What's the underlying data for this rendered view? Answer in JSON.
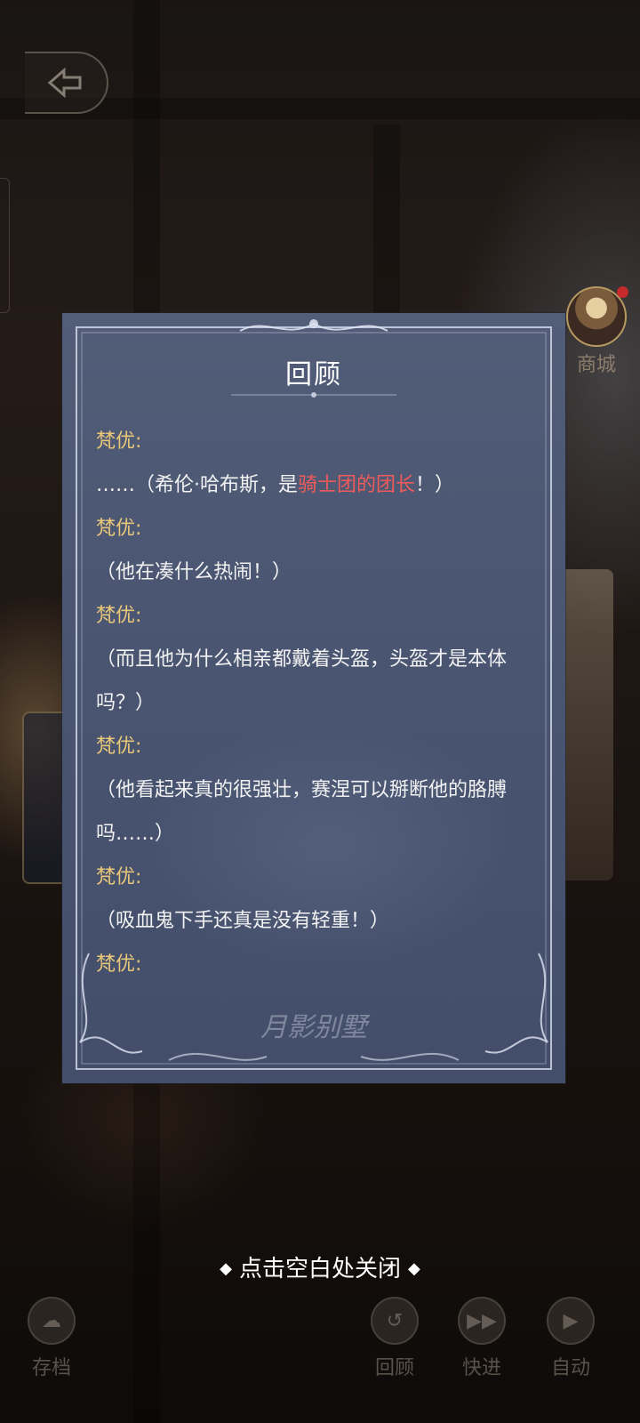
{
  "panel": {
    "title": "回顾",
    "logo_text": "月影别墅",
    "entries": [
      {
        "speaker": "梵优:",
        "segments": [
          {
            "text": "……（希伦·哈布斯，是"
          },
          {
            "text": "骑士团的团长",
            "hl": true
          },
          {
            "text": "！）"
          }
        ]
      },
      {
        "speaker": "梵优:",
        "segments": [
          {
            "text": "（他在凑什么热闹！）"
          }
        ]
      },
      {
        "speaker": "梵优:",
        "segments": [
          {
            "text": "（而且他为什么相亲都戴着头盔，头盔才是本体吗？）"
          }
        ]
      },
      {
        "speaker": "梵优:",
        "segments": [
          {
            "text": "（他看起来真的很强壮，赛涅可以掰断他的胳膊吗……）"
          }
        ]
      },
      {
        "speaker": "梵优:",
        "segments": [
          {
            "text": "（吸血鬼下手还真是没有轻重！）"
          }
        ]
      },
      {
        "speaker": "梵优:",
        "segments": []
      }
    ]
  },
  "hint": {
    "text": "点击空白处关闭",
    "diamond": "◆"
  },
  "shop": {
    "label": "商城"
  },
  "bottom_bar": {
    "save_label": "存档",
    "review_label": "回顾",
    "fast_label": "快进",
    "auto_label": "自动"
  },
  "colors": {
    "speaker": "#e9c779",
    "highlight": "#f05a5a",
    "panel_bg": "#4b5672"
  }
}
